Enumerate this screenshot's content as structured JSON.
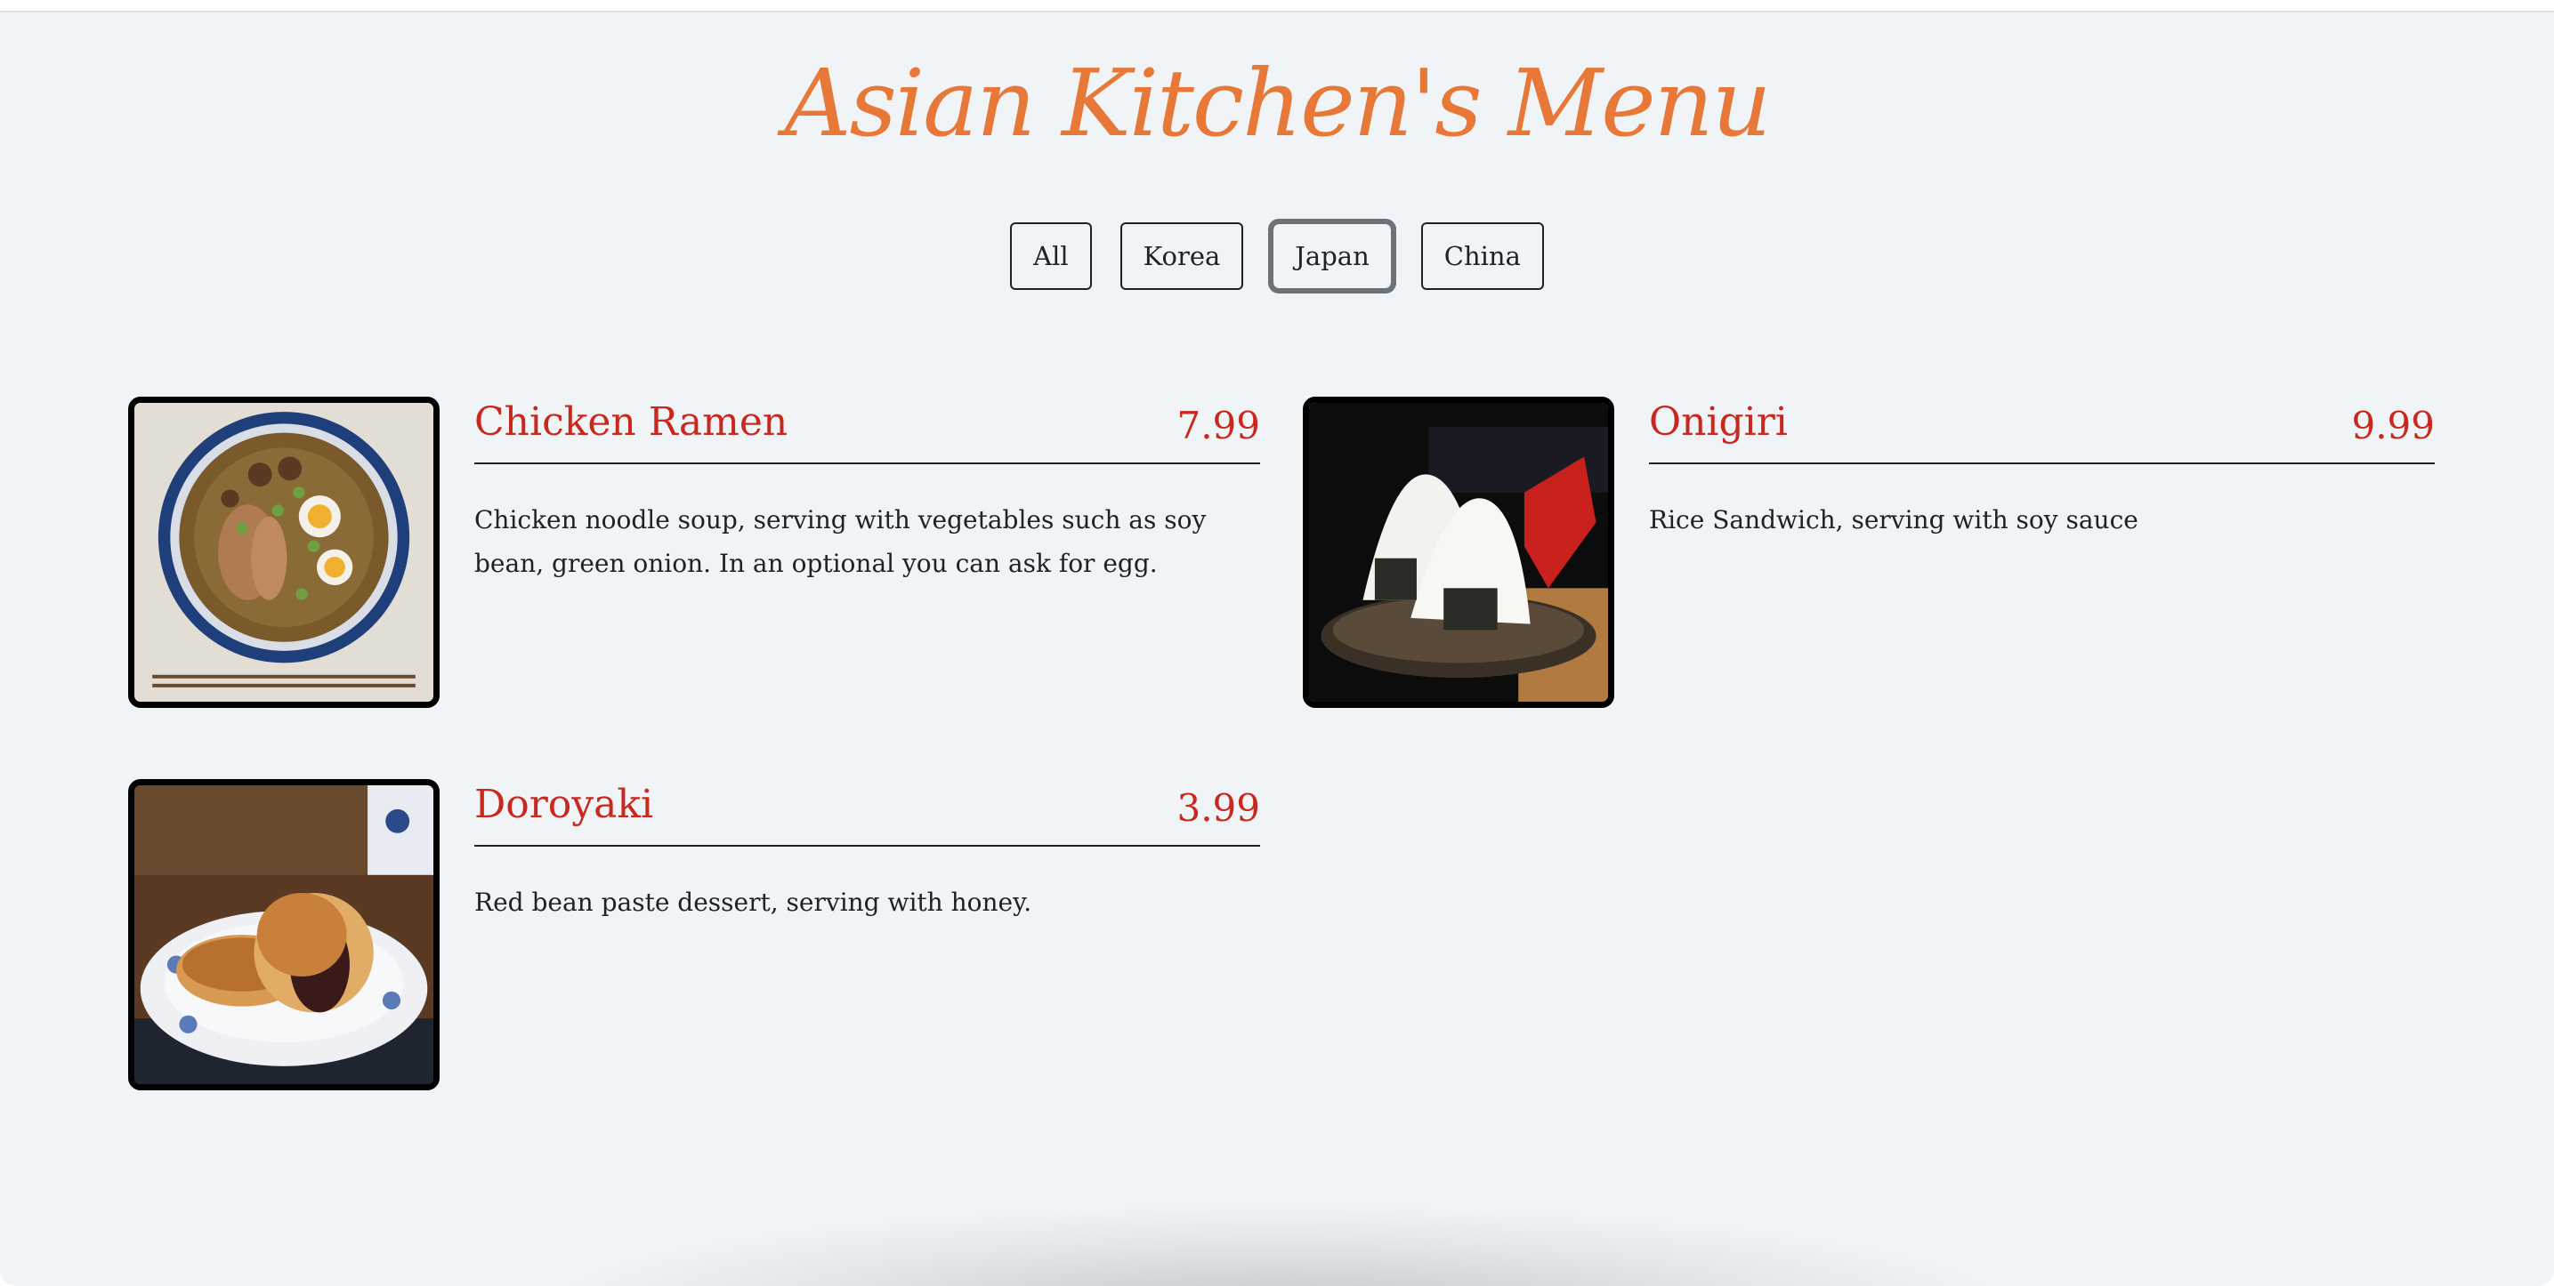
{
  "title": "Asian Kitchen's Menu",
  "filters": [
    {
      "label": "All"
    },
    {
      "label": "Korea"
    },
    {
      "label": "Japan"
    },
    {
      "label": "China"
    }
  ],
  "active_filter": "Japan",
  "items": [
    {
      "name": "Chicken Ramen",
      "price": "7.99",
      "desc": "Chicken noodle soup, serving with vegetables such as soy bean, green onion. In an optional you can ask for egg.",
      "image": "ramen-photo"
    },
    {
      "name": "Onigiri",
      "price": "9.99",
      "desc": "Rice Sandwich, serving with soy sauce",
      "image": "onigiri-photo"
    },
    {
      "name": "Doroyaki",
      "price": "3.99",
      "desc": "Red bean paste dessert, serving with honey.",
      "image": "dorayaki-photo"
    }
  ],
  "colors": {
    "title": "#e87837",
    "item_text": "#c8281e",
    "background": "#f0f4f7"
  }
}
